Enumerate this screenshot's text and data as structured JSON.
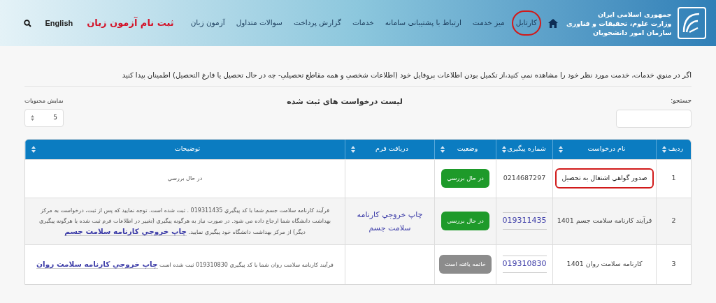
{
  "header": {
    "logo_lines": [
      "جمهوری اسلامی ایران",
      "وزارت علوم، تحقیقات و فناوری",
      "سازمان امور دانشجویان"
    ],
    "nav": [
      {
        "label": "کارتابل",
        "circled": true
      },
      {
        "label": "میز خدمت",
        "circled": false
      },
      {
        "label": "ارتباط با پشتیبانی سامانه",
        "circled": false
      },
      {
        "label": "خدمات",
        "circled": false
      },
      {
        "label": "گزارش پرداخت",
        "circled": false
      },
      {
        "label": "سوالات متداول",
        "circled": false
      },
      {
        "label": "آزمون زبان",
        "circled": false
      }
    ],
    "highlight_link": "ثبت نام آزمون زبان",
    "language": "English"
  },
  "notice": "اگر در منوي خدمات، خدمت مورد نظر خود را مشاهده نمي كنيد،از تكميل بودن اطلاعات پروفايل خود (اطلاعات شخصي و همه مقاطع تحصيلي- چه در حال تحصيل يا فارغ التحصيل) اطمينان پيدا كنيد",
  "list_title": "ليست درخواست های ثبت شده",
  "search": {
    "label": "جستجو:"
  },
  "page_size": {
    "label": "نمایش محتویات",
    "value": "5"
  },
  "table": {
    "columns": [
      "ردیف",
      "نام درخواست",
      "شماره پیگیری",
      "وضعیت",
      "دریافت فرم",
      "توضیحات"
    ],
    "rows": [
      {
        "index": "1",
        "name": "صدور گواهي اشتغال به تحصيل",
        "highlighted": true,
        "tracking": "0214687297",
        "tracking_link": false,
        "status": {
          "text": "در حال بررسي",
          "kind": "active"
        },
        "form_link": "",
        "description": "در حال بررسي",
        "description_link": ""
      },
      {
        "index": "2",
        "name": "فرآیند کارنامه سلامت جسم 1401",
        "highlighted": false,
        "tracking": "019311435",
        "tracking_link": true,
        "status": {
          "text": "در حال بررسي",
          "kind": "active"
        },
        "form_link": "چاپ خروجي كارنامه سلامت جسم",
        "description": "فرآيند كارنامه سلامت جسم شما با كد پيگيري 019311435 . ثبت شده است. توجه نماييد كه پس از ثبت، درخواست به مركز بهداشت دانشگاه شما ارجاع داده مي شود. در صورت نياز به هرگونه پيگيري (تغيير در اطلاعات فرم ثبت شده يا هرگونه پيگيري ديگر) از مركز بهداشت دانشگاه خود پيگيري نماييد.",
        "description_link": "چاپ خروجي كارنامه سلامت جسم"
      },
      {
        "index": "3",
        "name": "کارنامه سلامت روان 1401",
        "highlighted": false,
        "tracking": "019310830",
        "tracking_link": true,
        "status": {
          "text": "خاتمه یافته است",
          "kind": "closed"
        },
        "form_link": "",
        "description": "فرآيند كارنامه سلامت روان شما با كد پيگيري 019310830 ثبت شده است",
        "description_link": "چاپ خروجي كارنامه سلامت روان"
      }
    ]
  }
}
